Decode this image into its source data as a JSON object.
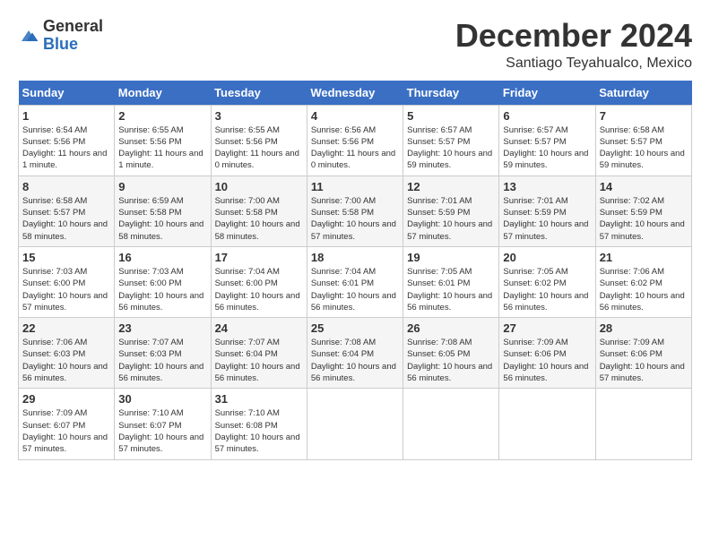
{
  "logo": {
    "general": "General",
    "blue": "Blue"
  },
  "title": {
    "month_year": "December 2024",
    "location": "Santiago Teyahualco, Mexico"
  },
  "calendar": {
    "headers": [
      "Sunday",
      "Monday",
      "Tuesday",
      "Wednesday",
      "Thursday",
      "Friday",
      "Saturday"
    ],
    "weeks": [
      [
        {
          "day": "1",
          "sunrise": "6:54 AM",
          "sunset": "5:56 PM",
          "daylight": "11 hours and 1 minute."
        },
        {
          "day": "2",
          "sunrise": "6:55 AM",
          "sunset": "5:56 PM",
          "daylight": "11 hours and 1 minute."
        },
        {
          "day": "3",
          "sunrise": "6:55 AM",
          "sunset": "5:56 PM",
          "daylight": "11 hours and 0 minutes."
        },
        {
          "day": "4",
          "sunrise": "6:56 AM",
          "sunset": "5:56 PM",
          "daylight": "11 hours and 0 minutes."
        },
        {
          "day": "5",
          "sunrise": "6:57 AM",
          "sunset": "5:57 PM",
          "daylight": "10 hours and 59 minutes."
        },
        {
          "day": "6",
          "sunrise": "6:57 AM",
          "sunset": "5:57 PM",
          "daylight": "10 hours and 59 minutes."
        },
        {
          "day": "7",
          "sunrise": "6:58 AM",
          "sunset": "5:57 PM",
          "daylight": "10 hours and 59 minutes."
        }
      ],
      [
        {
          "day": "8",
          "sunrise": "6:58 AM",
          "sunset": "5:57 PM",
          "daylight": "10 hours and 58 minutes."
        },
        {
          "day": "9",
          "sunrise": "6:59 AM",
          "sunset": "5:58 PM",
          "daylight": "10 hours and 58 minutes."
        },
        {
          "day": "10",
          "sunrise": "7:00 AM",
          "sunset": "5:58 PM",
          "daylight": "10 hours and 58 minutes."
        },
        {
          "day": "11",
          "sunrise": "7:00 AM",
          "sunset": "5:58 PM",
          "daylight": "10 hours and 57 minutes."
        },
        {
          "day": "12",
          "sunrise": "7:01 AM",
          "sunset": "5:59 PM",
          "daylight": "10 hours and 57 minutes."
        },
        {
          "day": "13",
          "sunrise": "7:01 AM",
          "sunset": "5:59 PM",
          "daylight": "10 hours and 57 minutes."
        },
        {
          "day": "14",
          "sunrise": "7:02 AM",
          "sunset": "5:59 PM",
          "daylight": "10 hours and 57 minutes."
        }
      ],
      [
        {
          "day": "15",
          "sunrise": "7:03 AM",
          "sunset": "6:00 PM",
          "daylight": "10 hours and 57 minutes."
        },
        {
          "day": "16",
          "sunrise": "7:03 AM",
          "sunset": "6:00 PM",
          "daylight": "10 hours and 56 minutes."
        },
        {
          "day": "17",
          "sunrise": "7:04 AM",
          "sunset": "6:00 PM",
          "daylight": "10 hours and 56 minutes."
        },
        {
          "day": "18",
          "sunrise": "7:04 AM",
          "sunset": "6:01 PM",
          "daylight": "10 hours and 56 minutes."
        },
        {
          "day": "19",
          "sunrise": "7:05 AM",
          "sunset": "6:01 PM",
          "daylight": "10 hours and 56 minutes."
        },
        {
          "day": "20",
          "sunrise": "7:05 AM",
          "sunset": "6:02 PM",
          "daylight": "10 hours and 56 minutes."
        },
        {
          "day": "21",
          "sunrise": "7:06 AM",
          "sunset": "6:02 PM",
          "daylight": "10 hours and 56 minutes."
        }
      ],
      [
        {
          "day": "22",
          "sunrise": "7:06 AM",
          "sunset": "6:03 PM",
          "daylight": "10 hours and 56 minutes."
        },
        {
          "day": "23",
          "sunrise": "7:07 AM",
          "sunset": "6:03 PM",
          "daylight": "10 hours and 56 minutes."
        },
        {
          "day": "24",
          "sunrise": "7:07 AM",
          "sunset": "6:04 PM",
          "daylight": "10 hours and 56 minutes."
        },
        {
          "day": "25",
          "sunrise": "7:08 AM",
          "sunset": "6:04 PM",
          "daylight": "10 hours and 56 minutes."
        },
        {
          "day": "26",
          "sunrise": "7:08 AM",
          "sunset": "6:05 PM",
          "daylight": "10 hours and 56 minutes."
        },
        {
          "day": "27",
          "sunrise": "7:09 AM",
          "sunset": "6:06 PM",
          "daylight": "10 hours and 56 minutes."
        },
        {
          "day": "28",
          "sunrise": "7:09 AM",
          "sunset": "6:06 PM",
          "daylight": "10 hours and 57 minutes."
        }
      ],
      [
        {
          "day": "29",
          "sunrise": "7:09 AM",
          "sunset": "6:07 PM",
          "daylight": "10 hours and 57 minutes."
        },
        {
          "day": "30",
          "sunrise": "7:10 AM",
          "sunset": "6:07 PM",
          "daylight": "10 hours and 57 minutes."
        },
        {
          "day": "31",
          "sunrise": "7:10 AM",
          "sunset": "6:08 PM",
          "daylight": "10 hours and 57 minutes."
        },
        null,
        null,
        null,
        null
      ]
    ]
  }
}
